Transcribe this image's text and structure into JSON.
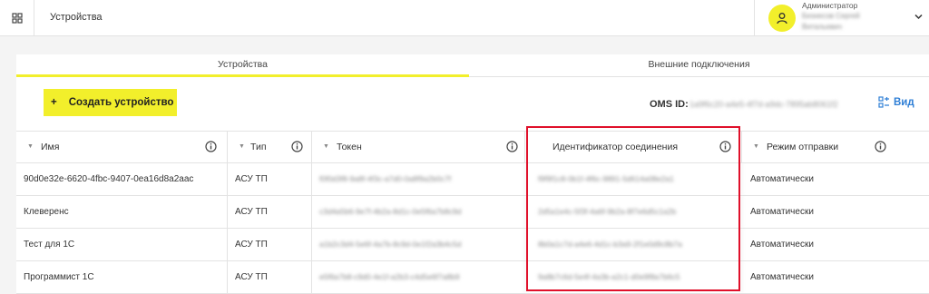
{
  "header": {
    "title": "Устройства",
    "menu_icon": "grid-icon",
    "user": {
      "role": "Администратор",
      "name_line1": "Бизнесов Сергей",
      "name_line2": "Витальевич",
      "avatar_icon": "user-icon",
      "accent": "#f2ef2b"
    }
  },
  "tabs": [
    {
      "label": "Устройства",
      "active": true
    },
    {
      "label": "Внешние подключения",
      "active": false
    }
  ],
  "toolbar": {
    "create_plus": "+",
    "create_label": "Создать устройство",
    "oms_label": "OMS ID:",
    "oms_value": "1a9f6c20-a4e5-4f7d-a9dc-7895ab8061f2",
    "view_label": "Вид",
    "view_color": "#2f7fd6"
  },
  "table": {
    "columns": [
      {
        "label": "Имя",
        "sortable": true
      },
      {
        "label": "Тип",
        "sortable": true
      },
      {
        "label": "Токен",
        "sortable": true
      },
      {
        "label": "Идентификатор соединения",
        "sortable": false
      },
      {
        "label": "Режим отправки",
        "sortable": true
      }
    ],
    "rows": [
      {
        "name": "90d0e32e-6620-4fbc-9407-0ea16d8a2aac",
        "type": "АСУ ТП",
        "token": "f0f0d3f8-9a8f-4f3c-a7d0-0a8f9a2b0c7f",
        "conn_id": "f9f9f1c8-0b1f-4f6c-9891-5d614a08e2a1",
        "mode": "Автоматически"
      },
      {
        "name": "Клеверенс",
        "type": "АСУ ТП",
        "token": "c3d4a5b6-9e7f-4b2a-8d1c-0e5f6a7b8c9d",
        "conn_id": "2d5a1e4c-5f3f-4a6f-9b2a-8f7e6d5c1a2b",
        "mode": "Автоматически"
      },
      {
        "name": "Тест для 1С",
        "type": "АСУ ТП",
        "token": "a1b2c3d4-5e6f-4a7b-8c9d-0e1f2a3b4c5d",
        "conn_id": "8b0a1c7d-a4e6-4d1c-b3a9-2f1e0d9c8b7a",
        "mode": "Автоматически"
      },
      {
        "name": "Программист 1С",
        "type": "АСУ ТП",
        "token": "e5f6a7b8-c9d0-4e1f-a2b3-c4d5e6f7a8b9",
        "conn_id": "9a8b7c6d-5e4f-4a3b-a2c1-d0e9f8a7b6c5",
        "mode": "Автоматически"
      }
    ]
  },
  "annotation": {
    "color": "#e0102a"
  }
}
